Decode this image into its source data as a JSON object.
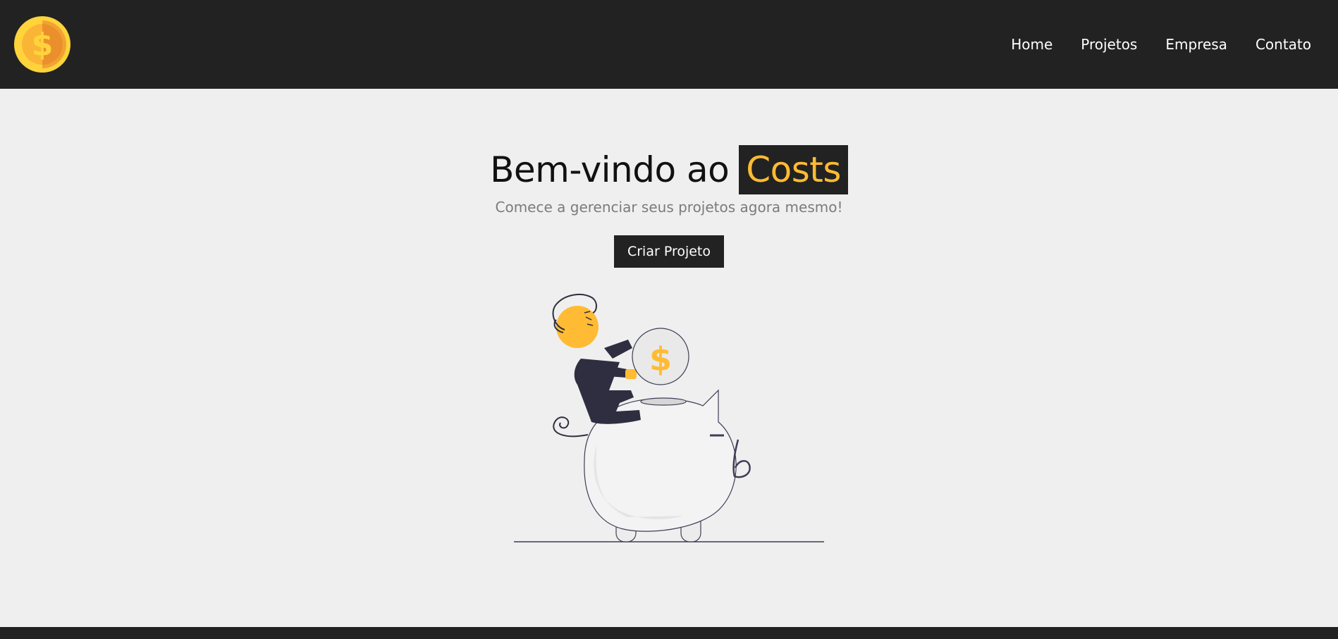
{
  "navbar": {
    "logo_icon": "dollar-coin-icon",
    "links": [
      {
        "label": "Home"
      },
      {
        "label": "Projetos"
      },
      {
        "label": "Empresa"
      },
      {
        "label": "Contato"
      }
    ]
  },
  "hero": {
    "title_prefix": "Bem-vindo ao",
    "title_brand": "Costs",
    "subtitle": "Comece a gerenciar seus projetos agora mesmo!",
    "cta_label": "Criar Projeto",
    "illustration": "piggy-bank-savings-illustration",
    "coin_symbol": "$"
  },
  "colors": {
    "navbar_bg": "#222222",
    "page_bg": "#efefef",
    "accent": "#ffbb33",
    "button_bg": "#222222",
    "subtitle": "#7b7b7b"
  }
}
